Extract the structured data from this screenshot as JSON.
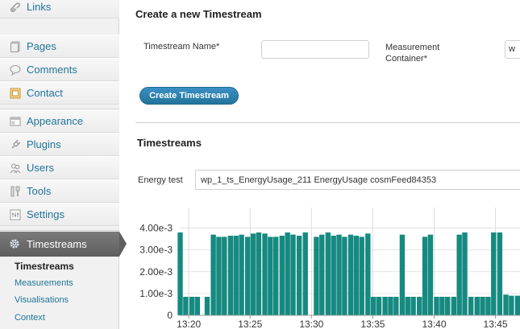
{
  "sidebar": {
    "items": [
      {
        "label": "Links",
        "icon": "link-icon"
      },
      {
        "label": "Pages",
        "icon": "pages-icon"
      },
      {
        "label": "Comments",
        "icon": "comment-icon"
      },
      {
        "label": "Contact",
        "icon": "contact-icon"
      },
      {
        "label": "Appearance",
        "icon": "appearance-icon"
      },
      {
        "label": "Plugins",
        "icon": "plugin-icon"
      },
      {
        "label": "Users",
        "icon": "users-icon"
      },
      {
        "label": "Tools",
        "icon": "tools-icon"
      },
      {
        "label": "Settings",
        "icon": "settings-icon"
      }
    ],
    "active": {
      "label": "Timestreams",
      "icon": "gear-icon"
    },
    "submenu": [
      "Timestreams",
      "Measurements",
      "Visualisations",
      "Context"
    ]
  },
  "create": {
    "title": "Create a new Timestream",
    "name_label": "Timestream Name*",
    "name_value": "",
    "container_label": "Measurement Container*",
    "container_value": "w",
    "button_label": "Create Timestream"
  },
  "timestreams": {
    "title": "Timestreams",
    "energy_label": "Energy test",
    "selected": "wp_1_ts_EnergyUsage_211 EnergyUsage cosmFeed84353"
  },
  "chart_data": {
    "type": "bar",
    "title": "",
    "xlabel": "",
    "ylabel": "",
    "ylim": [
      0,
      0.0045
    ],
    "y_ticks": [
      "0",
      "1.00e-3",
      "2.00e-3",
      "3.00e-3",
      "4.00e-3"
    ],
    "y_tick_values": [
      0,
      0.001,
      0.002,
      0.003,
      0.004
    ],
    "x_ticks": [
      "13:20",
      "13:25",
      "13:30",
      "13:35",
      "13:40",
      "13:45"
    ],
    "x_tick_minutes": [
      20,
      25,
      30,
      35,
      40,
      45
    ],
    "xlim_minutes": [
      19.2,
      47.0
    ],
    "bar_width_minutes": 0.42,
    "bar_color": "#168a80",
    "series": [
      {
        "x_minutes": [
          19.3,
          19.75,
          20.25,
          20.7,
          21.5,
          22.0,
          22.45,
          22.9,
          23.4,
          23.85,
          24.3,
          24.8,
          25.25,
          25.7,
          26.2,
          26.65,
          27.1,
          27.6,
          28.05,
          28.5,
          29.0,
          29.5,
          30.4,
          30.85,
          31.35,
          31.8,
          32.25,
          32.7,
          33.2,
          33.65,
          34.1,
          34.6,
          35.05,
          35.5,
          36.0,
          36.45,
          36.9,
          37.4,
          37.85,
          38.3,
          38.8,
          39.25,
          39.7,
          40.2,
          40.65,
          41.1,
          41.6,
          42.05,
          42.5,
          43.0,
          43.5,
          43.95,
          44.4,
          44.85,
          45.35,
          45.85,
          46.3,
          46.8
        ],
        "values": [
          0.0038,
          0.00085,
          0.00085,
          0.00085,
          0.00085,
          0.0037,
          0.0036,
          0.0036,
          0.00365,
          0.00365,
          0.0037,
          0.0036,
          0.00375,
          0.0038,
          0.00375,
          0.0036,
          0.0036,
          0.00365,
          0.0038,
          0.0037,
          0.00365,
          0.0038,
          0.0036,
          0.0037,
          0.0038,
          0.00365,
          0.0037,
          0.0036,
          0.0037,
          0.00365,
          0.0036,
          0.00375,
          0.00085,
          0.00085,
          0.00085,
          0.00085,
          0.00085,
          0.0037,
          0.00085,
          0.00085,
          0.00085,
          0.0036,
          0.0037,
          0.00085,
          0.00085,
          0.00085,
          0.00085,
          0.0037,
          0.0038,
          0.00085,
          0.00085,
          0.00085,
          0.00085,
          0.0038,
          0.0038,
          0.00095,
          0.0009,
          0.0009
        ]
      }
    ]
  }
}
